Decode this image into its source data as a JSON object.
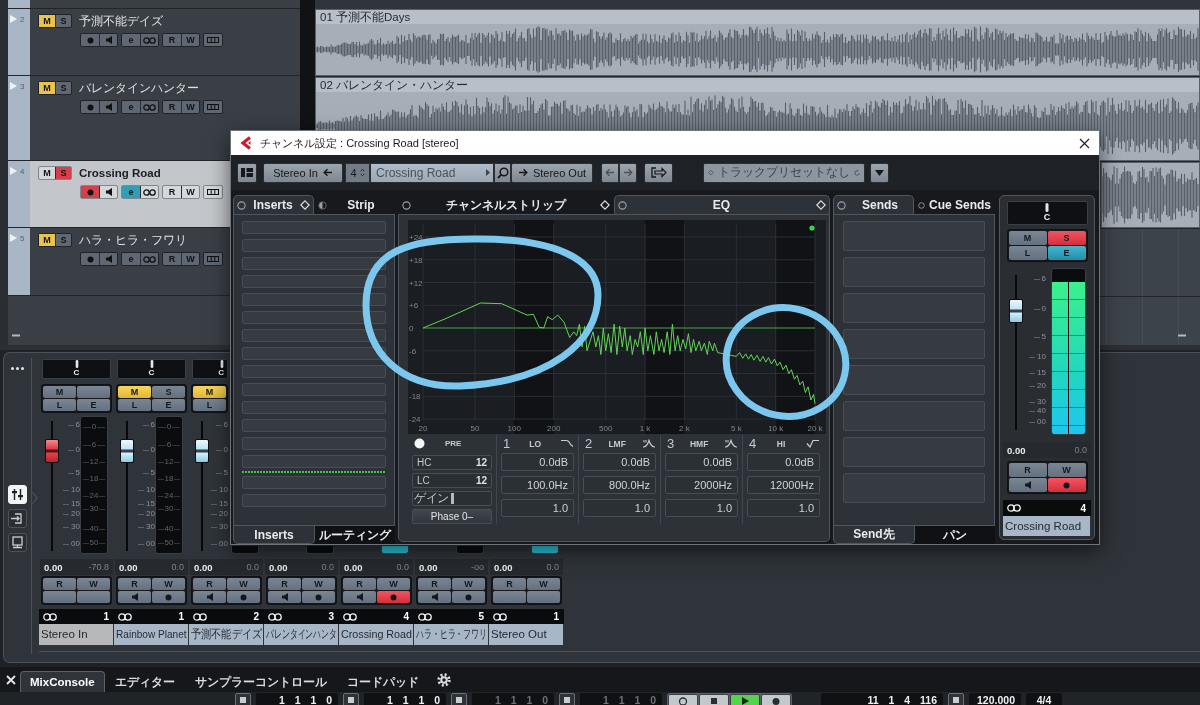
{
  "tracks": [
    {
      "number": "2",
      "name": "予測不能デイズ",
      "selected": false,
      "mute": {
        "label": "M",
        "on": true
      },
      "solo": {
        "label": "S",
        "on": false
      },
      "record": false,
      "edit": {
        "label": "e",
        "on": false
      },
      "read": "R",
      "write": "W"
    },
    {
      "number": "3",
      "name": "バレンタインハンター",
      "selected": false,
      "mute": {
        "label": "M",
        "on": true
      },
      "solo": {
        "label": "S",
        "on": false
      },
      "record": false,
      "edit": {
        "label": "e",
        "on": false
      },
      "read": "R",
      "write": "W"
    },
    {
      "number": "4",
      "name": "Crossing Road",
      "selected": true,
      "mute": {
        "label": "M",
        "on": false
      },
      "solo": {
        "label": "S",
        "on": true
      },
      "record": true,
      "edit": {
        "label": "e",
        "on": true
      },
      "read": "R",
      "write": "W"
    },
    {
      "number": "5",
      "name": "ハラ・ヒラ・フワリ",
      "selected": false,
      "mute": {
        "label": "M",
        "on": true
      },
      "solo": {
        "label": "S",
        "on": false
      },
      "record": false,
      "edit": {
        "label": "e",
        "on": false
      },
      "read": "R",
      "write": "W"
    }
  ],
  "arrangement": {
    "clips": [
      {
        "kind": "full",
        "label": "01 予測不能Days"
      },
      {
        "kind": "full",
        "label": "02 バレンタイン・ハンター"
      },
      {
        "kind": "edge"
      }
    ]
  },
  "mixer": {
    "views": [
      {
        "kind": "faders",
        "selected": true
      },
      {
        "kind": "routing",
        "selected": false
      },
      {
        "kind": "monitor",
        "selected": false
      }
    ],
    "channels": [
      {
        "kind": "input",
        "pan": "C",
        "mute": {
          "label": "M",
          "on": false
        },
        "listen": {
          "label": "L",
          "on": false
        },
        "edit": {
          "label": "E",
          "on": false
        },
        "fader": {
          "level": 0.77
        },
        "fader_scale": [
          "6",
          "0",
          "5",
          "10",
          "15",
          "20",
          "30",
          "00"
        ],
        "meter": {
          "level": 0
        },
        "meter_scale": [
          "0",
          "6",
          "12",
          "18",
          "24",
          "30",
          "40",
          "50"
        ],
        "volume": "0.00",
        "peak": "-70.8",
        "read": "R",
        "write": "W",
        "number": "1",
        "name": "Stereo In"
      },
      {
        "kind": "audio",
        "pan": "C",
        "mute": {
          "label": "M",
          "on": true
        },
        "solo": {
          "label": "S",
          "on": false
        },
        "listen": {
          "label": "L",
          "on": false
        },
        "edit": {
          "label": "E",
          "on": false
        },
        "fader": {
          "level": 0.77
        },
        "fader_scale": [
          "6",
          "0",
          "5",
          "10",
          "15",
          "20",
          "30",
          "00"
        ],
        "meter": {
          "level": 0
        },
        "meter_scale": [
          "0",
          "6",
          "12",
          "18",
          "24",
          "30",
          "40",
          "50"
        ],
        "volume": "0.00",
        "peak": "0.0",
        "read": "R",
        "write": "W",
        "record": false,
        "number": "1",
        "name": "Rainbow Planet"
      },
      {
        "kind": "audio",
        "pan": "C",
        "mute": {
          "label": "M",
          "on": true
        },
        "listen": {
          "label": "L",
          "on": false
        },
        "fader": {
          "level": 0.77
        },
        "fader_scale": [
          "6",
          "0",
          "5",
          "10",
          "15",
          "20",
          "30",
          "00"
        ],
        "signal": false,
        "volume": "0.00",
        "peak": "0.0",
        "read": "R",
        "write": "W",
        "record": false,
        "number": "2",
        "name": "予測不能デイズ"
      },
      {
        "kind": "audio",
        "signal": false,
        "volume": "0.00",
        "peak": "0.0",
        "read": "R",
        "write": "W",
        "record": false,
        "number": "3",
        "name": "バレンタインハンタ"
      },
      {
        "kind": "audio",
        "signal": true,
        "volume": "0.00",
        "peak": "0.0",
        "read": "R",
        "write": "W",
        "record": true,
        "number": "4",
        "name": "Crossing Road"
      },
      {
        "kind": "audio",
        "signal": false,
        "volume": "0.00",
        "peak": "-oo",
        "read": "R",
        "write": "W",
        "record": false,
        "number": "5",
        "name": "ハラ・ヒラ・フワリ"
      },
      {
        "kind": "output",
        "signal": true,
        "volume": "0.00",
        "peak": "0.0",
        "read": "R",
        "write": "W",
        "number": "1",
        "name": "Stereo Out"
      }
    ]
  },
  "lower_zone": {
    "tabs": [
      {
        "label": "MixConsole",
        "selected": true
      },
      {
        "label": "エディター",
        "selected": false
      },
      {
        "label": "サンプラーコントロール",
        "selected": false
      },
      {
        "label": "コードパッド",
        "selected": false
      }
    ]
  },
  "transport": {
    "counters": [
      {
        "value": "1 1 1 0",
        "dimmed": false
      },
      {
        "value": "1 1 1 0",
        "dimmed": false
      },
      {
        "value": "1 1 1 0",
        "dimmed": true
      },
      {
        "value": "1 1 1 0",
        "dimmed": true
      }
    ],
    "playing": true,
    "position": "11 1 4 116",
    "tempo": "120.000",
    "signature": "4/4"
  },
  "channel_settings": {
    "title": "チャンネル設定 : Crossing Road [stereo]",
    "toolbar": {
      "input": "Stereo In",
      "number": "4",
      "channel": "Crossing Road",
      "output": "Stereo Out",
      "preset": "トラックプリセットなし"
    },
    "inserts": {
      "tabs": [
        {
          "label": "Inserts",
          "selected": true
        },
        {
          "label": "Strip",
          "selected": false
        }
      ],
      "slots": [
        {
          "kind": "slot"
        },
        {
          "kind": "slot"
        },
        {
          "kind": "slot"
        },
        {
          "kind": "slot"
        },
        {
          "kind": "slot"
        },
        {
          "kind": "slot"
        },
        {
          "kind": "slot"
        },
        {
          "kind": "slot"
        },
        {
          "kind": "slot"
        },
        {
          "kind": "slot"
        },
        {
          "kind": "slot"
        },
        {
          "kind": "slot"
        },
        {
          "kind": "slot"
        },
        {
          "kind": "slot"
        },
        {
          "kind": "divider"
        },
        {
          "kind": "slot"
        },
        {
          "kind": "slot"
        }
      ],
      "bottom_tabs": [
        {
          "label": "Inserts",
          "selected": true
        },
        {
          "label": "ルーティング",
          "selected": false
        }
      ]
    },
    "center_tabs": [
      {
        "label": "チャンネルストリップ",
        "selected": false
      },
      {
        "label": "EQ",
        "selected": true
      }
    ],
    "eq": {
      "enabled": true,
      "chart_data": {
        "type": "line",
        "log": "x",
        "grid": true,
        "xlim": [
          20,
          20000
        ],
        "ylim": [
          -24,
          24
        ],
        "xticks": [
          20,
          50,
          100,
          200,
          500,
          {
            "value": 1000,
            "label": "1 k"
          },
          {
            "value": 2000,
            "label": "2 k"
          },
          {
            "value": 5000,
            "label": "5 k"
          },
          {
            "value": 10000,
            "label": "10 k"
          },
          {
            "value": 20000,
            "label": "20 k"
          }
        ],
        "yticks": [
          {
            "value": 24,
            "label": "+24"
          },
          {
            "value": 18,
            "label": "+18"
          },
          {
            "value": 12,
            "label": "+12"
          },
          {
            "value": 6,
            "label": "+6"
          },
          0,
          -6,
          -18,
          -24
        ],
        "x": [
          20,
          30,
          55,
          80,
          105,
          125,
          140,
          155,
          168,
          180,
          195,
          215,
          240,
          265,
          285,
          300,
          315,
          330,
          345,
          360,
          400,
          420,
          440,
          460,
          480,
          500,
          525,
          550,
          580,
          610,
          640,
          670,
          700,
          730,
          770,
          800,
          840,
          880,
          920,
          970,
          1000,
          1050,
          1100,
          1170,
          1220,
          1280,
          1340,
          1400,
          1480,
          1550,
          1620,
          1700,
          1780,
          1860,
          1950,
          2050,
          2150,
          2250,
          2350,
          2450,
          2600,
          2700,
          2850,
          3000,
          3100,
          3300,
          3400,
          3600,
          5000,
          5300,
          5600,
          5900,
          6200,
          6500,
          6800,
          7200,
          7600,
          8000,
          8400,
          8800,
          9300,
          9800,
          10300,
          10800,
          11400,
          12000,
          12600,
          13200,
          13900,
          14600,
          15300,
          16100,
          16900,
          17700,
          18600,
          19500,
          20000
        ],
        "series": [
          {
            "color": "#63d35a",
            "values": [
              0,
              2.5,
              6.6,
              6.4,
              4.6,
              3.4,
              3.6,
              0.2,
              0,
              3,
              2.2,
              3.4,
              1.5,
              -2.5,
              -1,
              -2,
              1,
              -5,
              0.5,
              -6,
              -1,
              -5,
              -2,
              -7,
              0,
              -6,
              -1.5,
              -6.5,
              1,
              -7,
              0.5,
              -5,
              0,
              -6,
              -2,
              -7,
              -3,
              -5,
              -1,
              -7,
              0,
              -6,
              -2,
              -7,
              -1,
              -6,
              -3,
              -6.5,
              -1,
              -7,
              1,
              -6,
              -2,
              -6,
              -3,
              -5.5,
              -1.5,
              -6.5,
              -3,
              -6,
              -3.5,
              -6,
              -4,
              -7,
              -3.5,
              -6,
              -4,
              -6.5,
              -7.5,
              -6.5,
              -8,
              -6.8,
              -8.2,
              -7,
              -8.5,
              -7.2,
              -8.8,
              -7.5,
              -9,
              -7.8,
              -9.5,
              -8.2,
              -10,
              -9,
              -11,
              -9.8,
              -12,
              -11,
              -13.5,
              -12.5,
              -15,
              -14,
              -17,
              -15.5,
              -19,
              -17.5,
              -20
            ]
          },
          {
            "color": "#3e9a3a",
            "x": [
              20,
              20000
            ],
            "values": [
              0,
              0
            ]
          }
        ]
      },
      "pre": {
        "label": "PRE",
        "on": true
      },
      "high_cut": {
        "label": "HC",
        "slope": "12"
      },
      "low_cut": {
        "label": "LC",
        "slope": "12"
      },
      "gain": {
        "label": "ゲイン",
        "level": 0.5
      },
      "phase": "Phase 0–",
      "bands": [
        {
          "number": "1",
          "name": "LO",
          "kind": "low-shelf",
          "gain": "0.0dB",
          "frequency": "100.0Hz",
          "q": "1.0"
        },
        {
          "number": "2",
          "name": "LMF",
          "kind": "peak",
          "gain": "0.0dB",
          "frequency": "800.0Hz",
          "q": "1.0"
        },
        {
          "number": "3",
          "name": "HMF",
          "kind": "peak",
          "gain": "0.0dB",
          "frequency": "2000Hz",
          "q": "1.0"
        },
        {
          "number": "4",
          "name": "HI",
          "kind": "high-shelf",
          "gain": "0.0dB",
          "frequency": "12000Hz",
          "q": "1.0"
        }
      ]
    },
    "sends": {
      "tabs": [
        {
          "label": "Sends",
          "selected": true
        },
        {
          "label": "Cue Sends",
          "selected": false
        }
      ],
      "slots": [
        {
          "kind": "slot"
        },
        {
          "kind": "slot"
        },
        {
          "kind": "slot"
        },
        {
          "kind": "slot"
        },
        {
          "kind": "slot"
        },
        {
          "kind": "slot"
        },
        {
          "kind": "slot"
        },
        {
          "kind": "slot"
        }
      ],
      "bottom_tabs": [
        {
          "label": "Send先",
          "selected": true
        },
        {
          "label": "パン",
          "selected": false
        }
      ]
    },
    "strip": {
      "kind": "audio",
      "pan": "C",
      "mute": {
        "label": "M",
        "on": false
      },
      "solo": {
        "label": "S",
        "on": true
      },
      "listen": {
        "label": "L",
        "on": false
      },
      "edit": {
        "label": "E",
        "on": true
      },
      "fader": {
        "level": 0.77
      },
      "fader_scale": [
        "6",
        "0",
        "5",
        "10",
        "15",
        "20",
        "30",
        "40",
        "00"
      ],
      "meter": {
        "level": 0.92
      },
      "volume": "0.00",
      "peak": "0.0",
      "read": "R",
      "write": "W",
      "record": true,
      "number": "4",
      "name": "Crossing Road"
    }
  }
}
